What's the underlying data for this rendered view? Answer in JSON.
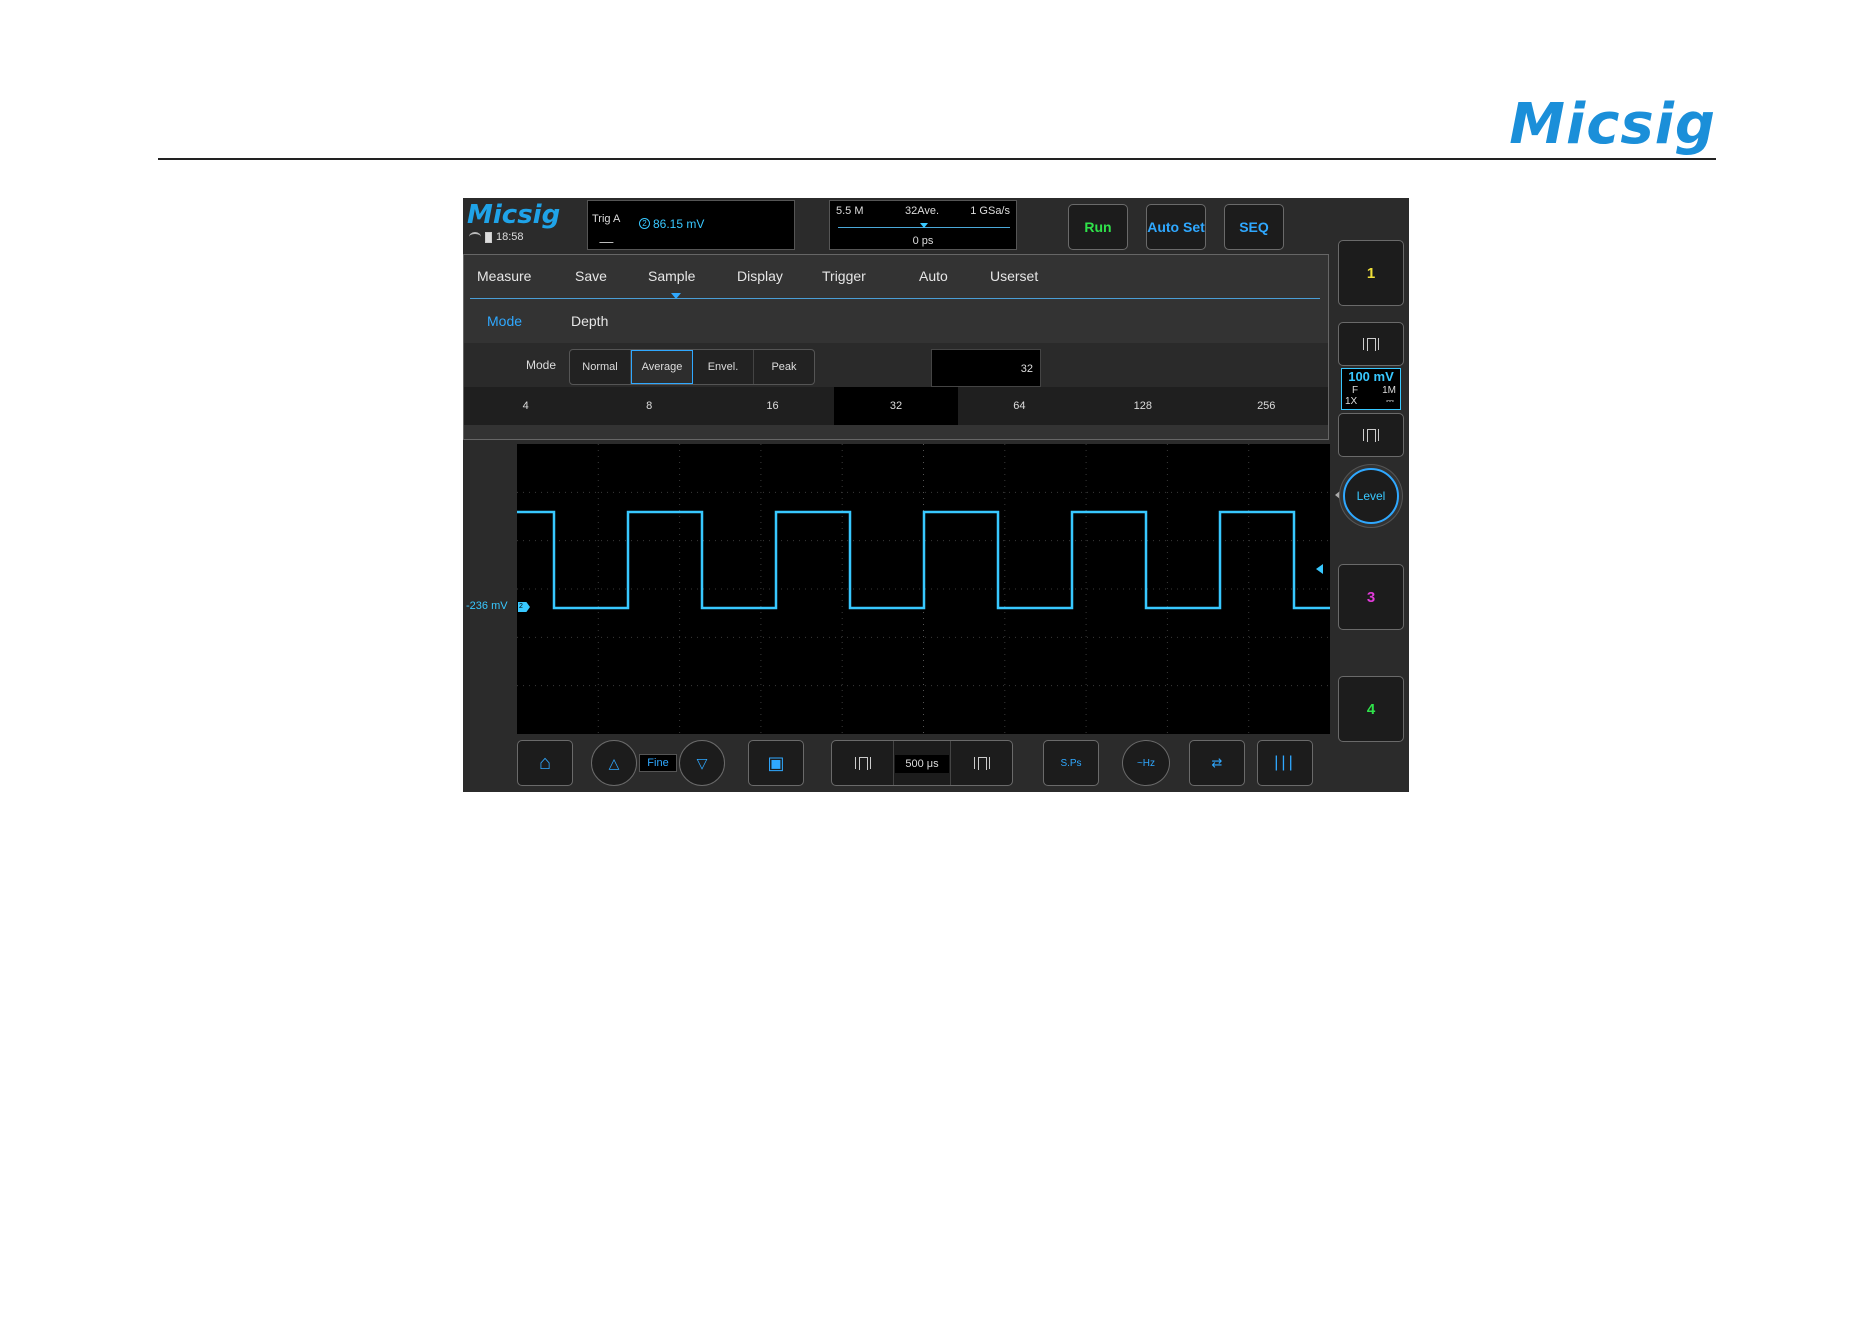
{
  "document": {
    "logo_text": "Micsig"
  },
  "topbar": {
    "logo_text": "Micsig",
    "time": "18:58",
    "trigger": {
      "label": "Trig A",
      "channel": "2",
      "value": "86.15 mV"
    },
    "acquisition": {
      "depth": "5.5 M",
      "averages": "32Ave.",
      "sample_rate": "1 GSa/s",
      "offset": "0 ps"
    },
    "buttons": {
      "run": "Run",
      "autoset": "Auto Set",
      "seq": "SEQ"
    }
  },
  "menu": {
    "tabs": [
      {
        "label": "Measure"
      },
      {
        "label": "Save"
      },
      {
        "label": "Sample"
      },
      {
        "label": "Display"
      },
      {
        "label": "Trigger"
      },
      {
        "label": "Auto"
      },
      {
        "label": "Userset"
      }
    ],
    "active_tab": "Sample",
    "subtabs": {
      "mode": "Mode",
      "depth": "Depth"
    },
    "mode_row": {
      "label": "Mode",
      "options": [
        "Normal",
        "Average",
        "Envel.",
        "Peak"
      ],
      "selected": "Average",
      "value": "32"
    },
    "average_counts": [
      "4",
      "8",
      "16",
      "32",
      "64",
      "128",
      "256"
    ],
    "selected_count": "32"
  },
  "waveform": {
    "offset_label": "-236 mV",
    "channel_marker": "2",
    "color": "#38c8ff"
  },
  "side": {
    "ch1": "1",
    "ch2_volt": "100 mV",
    "ch2_f": "F",
    "ch2_impedance": "1M",
    "ch2_probe": "1X",
    "ch2_coupling": "⎓",
    "level": "Level",
    "ch3": "3",
    "ch4": "4",
    "colors": {
      "ch1": "#f0e03a",
      "ch2": "#38c8ff",
      "ch3": "#e03ad8",
      "ch4": "#2fe24a"
    }
  },
  "bottombar": {
    "home_icon": "⌂",
    "fine_label": "Fine",
    "fine_up_icon": "△",
    "fine_down_icon": "▽",
    "save_icon": "▣",
    "timebase": "500 μs",
    "screenshot_label": "S.Ps",
    "freq_label": "~Hz",
    "swap_icon": "⇄",
    "cursor_icon": "|||"
  }
}
